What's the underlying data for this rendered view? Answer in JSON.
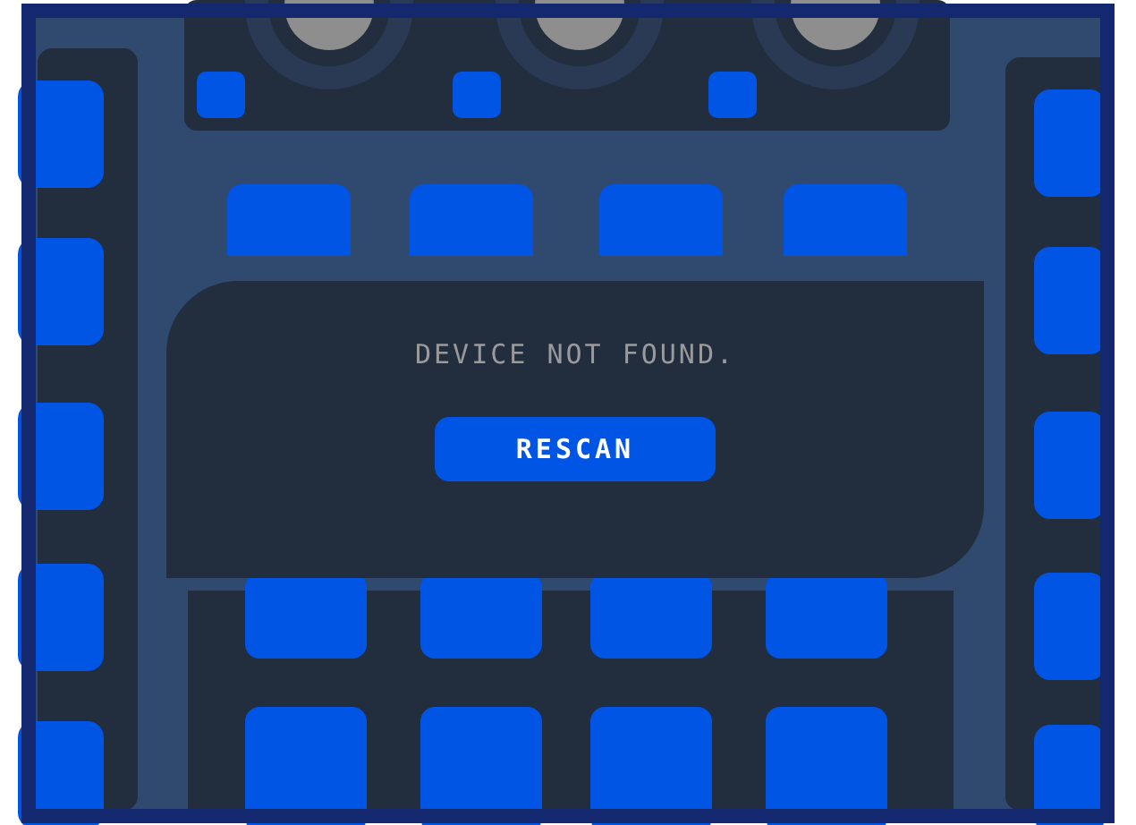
{
  "dialog": {
    "message": "DEVICE NOT FOUND.",
    "button": "RESCAN"
  }
}
